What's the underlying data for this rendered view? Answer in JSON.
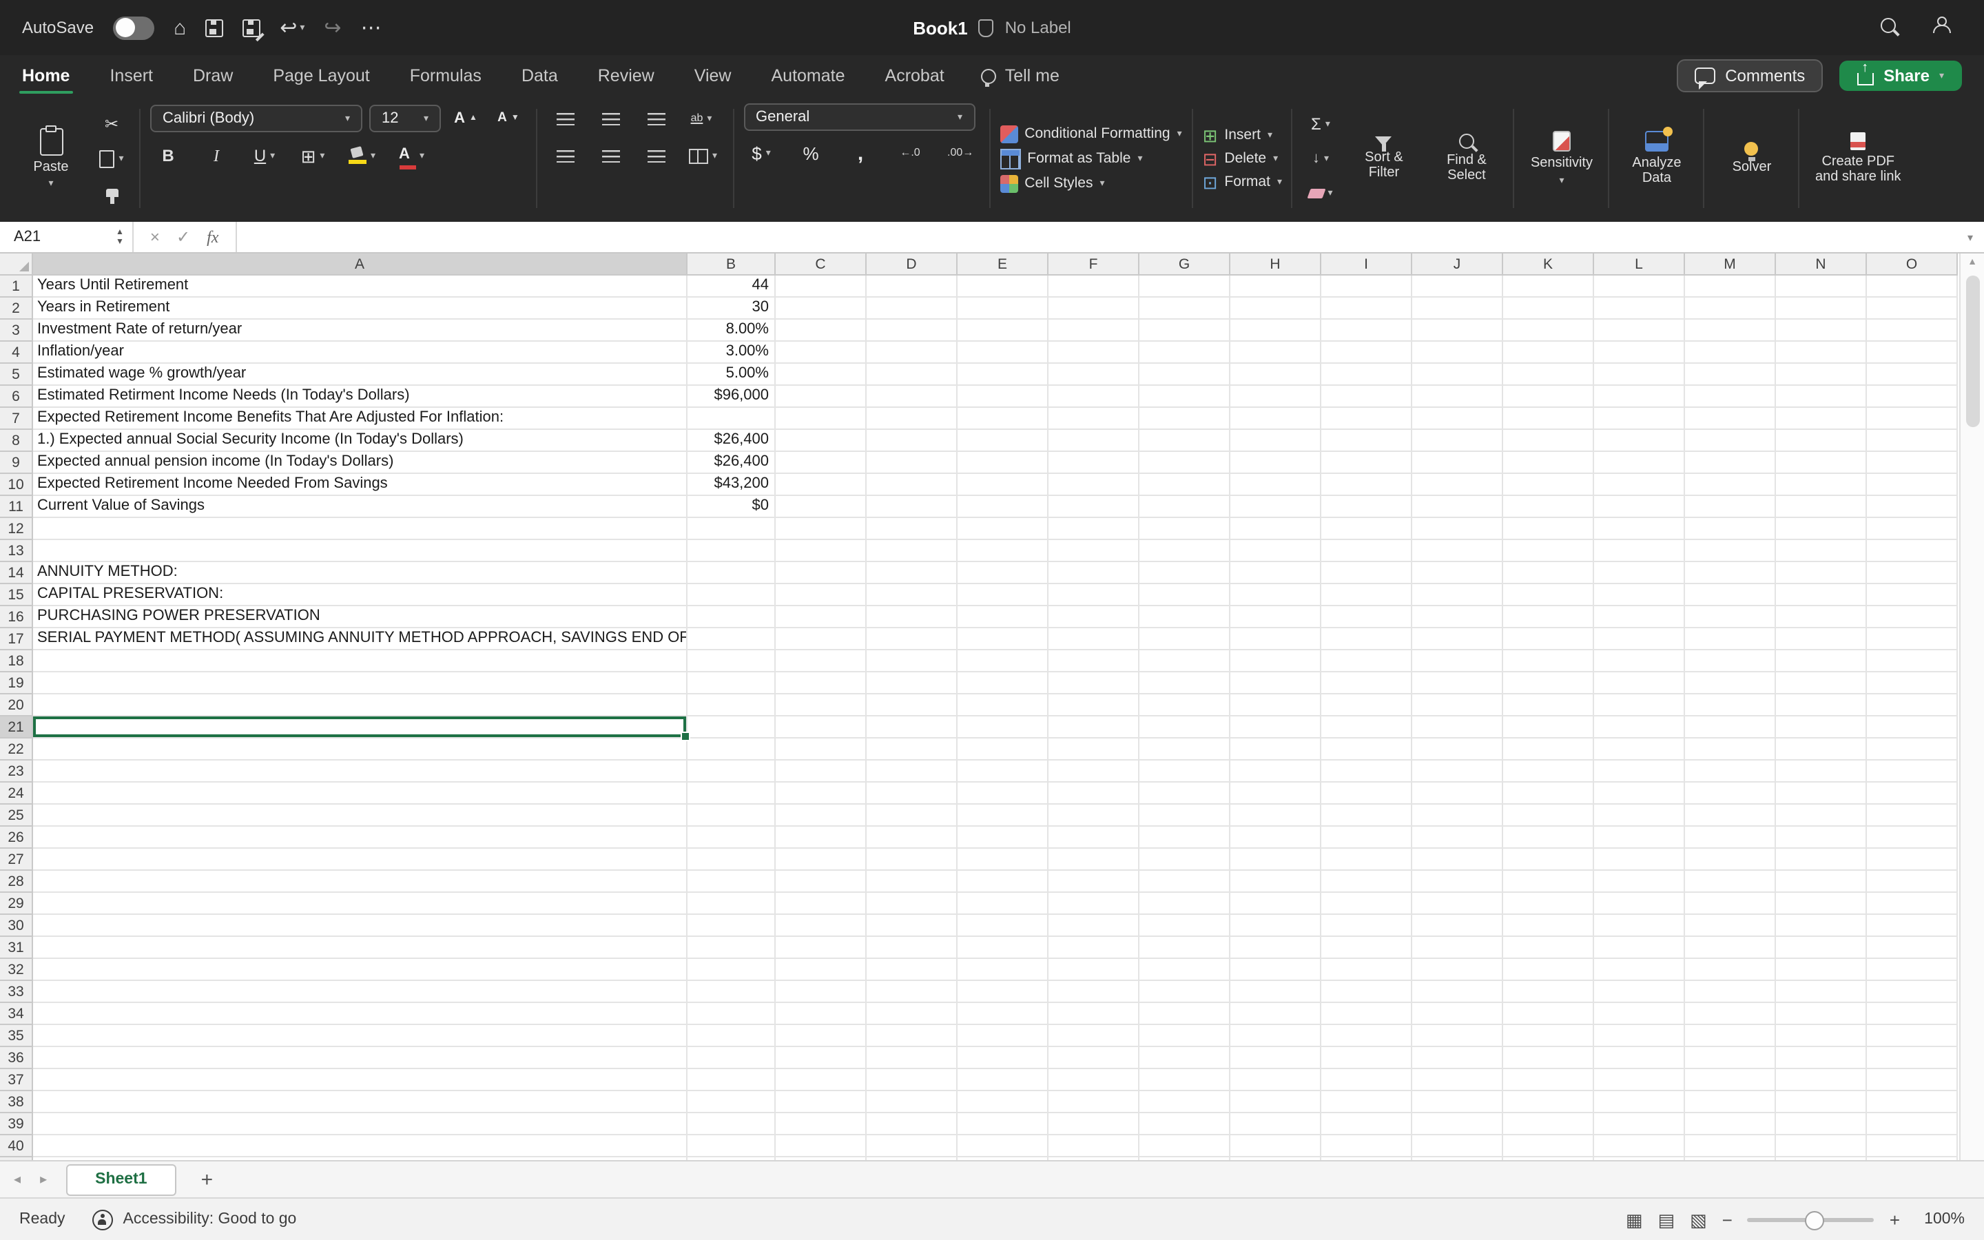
{
  "titlebar": {
    "autosave": "AutoSave",
    "title": "Book1",
    "label": "No Label"
  },
  "tabs_row": {
    "tabs": [
      "Home",
      "Insert",
      "Draw",
      "Page Layout",
      "Formulas",
      "Data",
      "Review",
      "View",
      "Automate",
      "Acrobat"
    ],
    "active": "Home",
    "tell_me": "Tell me",
    "comments": "Comments",
    "share": "Share"
  },
  "ribbon": {
    "paste": "Paste",
    "font_name": "Calibri (Body)",
    "font_size": "12",
    "grow_font": "A",
    "shrink_font": "A",
    "bold": "B",
    "italic": "I",
    "underline": "U",
    "wrap": "ab",
    "number_format": "General",
    "currency": "$",
    "percent": "%",
    "comma": ",",
    "increase_decimal": "←.0",
    "decrease_decimal": ".00→",
    "conditional_formatting": "Conditional Formatting",
    "format_as_table": "Format as Table",
    "cell_styles": "Cell Styles",
    "insert": "Insert",
    "delete": "Delete",
    "format": "Format",
    "sort_filter": [
      "Sort &",
      "Filter"
    ],
    "find_select": [
      "Find &",
      "Select"
    ],
    "sensitivity": "Sensitivity",
    "analyze_data": [
      "Analyze",
      "Data"
    ],
    "solver": "Solver",
    "create_pdf": [
      "Create PDF",
      "and share link"
    ]
  },
  "formula_bar": {
    "name_box": "A21",
    "fx": "fx",
    "value": ""
  },
  "sheet": {
    "columns": [
      "A",
      "B",
      "C",
      "D",
      "E",
      "F",
      "G",
      "H",
      "I",
      "J",
      "K",
      "L",
      "M",
      "N",
      "O"
    ],
    "row_count": 41,
    "selected_cell": "A21",
    "selected_row": 21,
    "selected_col": "A",
    "rows": [
      {
        "n": 1,
        "A": "Years Until Retirement",
        "B": "44"
      },
      {
        "n": 2,
        "A": "Years in Retirement",
        "B": "30"
      },
      {
        "n": 3,
        "A": "Investment Rate of return/year",
        "B": "8.00%"
      },
      {
        "n": 4,
        "A": "Inflation/year",
        "B": "3.00%"
      },
      {
        "n": 5,
        "A": "Estimated wage % growth/year",
        "B": "5.00%"
      },
      {
        "n": 6,
        "A": "Estimated Retirment Income Needs (In Today's Dollars)",
        "B": "$96,000"
      },
      {
        "n": 7,
        "A": "Expected Retirement Income Benefits That Are Adjusted For Inflation:",
        "B": ""
      },
      {
        "n": 8,
        "A": "1.) Expected annual Social Security Income (In Today's Dollars)",
        "B": "$26,400"
      },
      {
        "n": 9,
        "A": "Expected annual pension income (In Today's Dollars)",
        "B": "$26,400"
      },
      {
        "n": 10,
        "A": "Expected Retirement Income Needed From Savings",
        "B": "$43,200"
      },
      {
        "n": 11,
        "A": "Current Value of Savings",
        "B": "$0"
      },
      {
        "n": 14,
        "A": "ANNUITY METHOD:",
        "B": ""
      },
      {
        "n": 15,
        "A": "CAPITAL PRESERVATION:",
        "B": ""
      },
      {
        "n": 16,
        "A": "PURCHASING POWER PRESERVATION",
        "B": ""
      },
      {
        "n": 17,
        "A": "SERIAL PAYMENT METHOD( ASSUMING ANNUITY METHOD APPROACH, SAVINGS END OF YEAR)",
        "B": ""
      }
    ]
  },
  "sheet_tabs": {
    "tabs": [
      "Sheet1"
    ],
    "active": "Sheet1",
    "add": "+"
  },
  "status_bar": {
    "ready": "Ready",
    "accessibility": "Accessibility: Good to go",
    "zoom": "100%"
  },
  "colors": {
    "accent_green": "#217346",
    "selection_border": "#1E7145",
    "share_button": "#1F8A4A"
  },
  "icons": {
    "chevron": "▾",
    "home": "⌂",
    "undo": "↩",
    "redo": "↪",
    "more": "⋯",
    "sum": "Σ",
    "scissors": "✂",
    "borders": "⊞",
    "close": "×",
    "check": "✓",
    "view_normal": "▦",
    "view_layout": "▤",
    "view_break": "▧",
    "minus": "−",
    "plus": "+",
    "prev": "◂",
    "next": "▸",
    "step_up": "▲",
    "step_down": "▼",
    "fill_down": "↓",
    "insert_glyph": "⊞",
    "delete_glyph": "⊟",
    "format_glyph": "⊡"
  }
}
